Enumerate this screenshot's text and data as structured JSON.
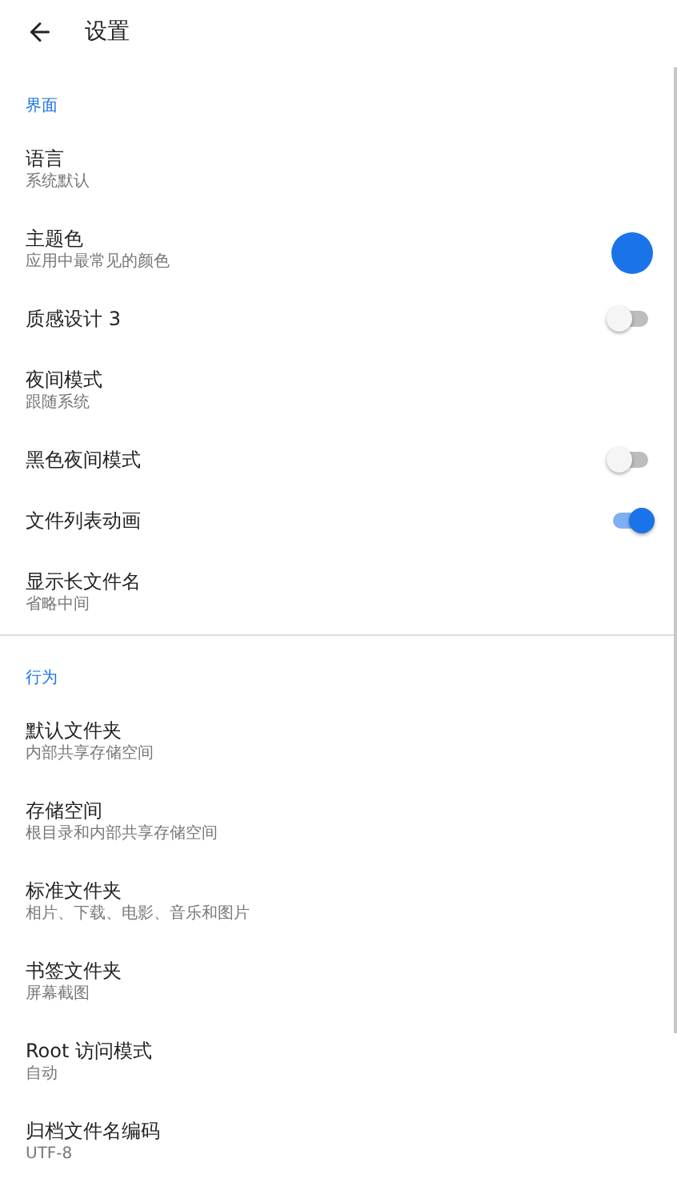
{
  "app_bar": {
    "title": "设置"
  },
  "sections": [
    {
      "header": "界面",
      "items": [
        {
          "kind": "plain",
          "title": "语言",
          "subtitle": "系统默认"
        },
        {
          "kind": "color",
          "title": "主题色",
          "subtitle": "应用中最常见的颜色",
          "color": "#1a73e8"
        },
        {
          "kind": "switch",
          "title": "质感设计 3",
          "on": false
        },
        {
          "kind": "plain",
          "title": "夜间模式",
          "subtitle": "跟随系统"
        },
        {
          "kind": "switch",
          "title": "黑色夜间模式",
          "on": false
        },
        {
          "kind": "switch",
          "title": "文件列表动画",
          "on": true
        },
        {
          "kind": "plain",
          "title": "显示长文件名",
          "subtitle": "省略中间"
        }
      ]
    },
    {
      "header": "行为",
      "items": [
        {
          "kind": "plain",
          "title": "默认文件夹",
          "subtitle": "内部共享存储空间"
        },
        {
          "kind": "plain",
          "title": "存储空间",
          "subtitle": "根目录和内部共享存储空间"
        },
        {
          "kind": "plain",
          "title": "标准文件夹",
          "subtitle": "相片、下载、电影、音乐和图片"
        },
        {
          "kind": "plain",
          "title": "书签文件夹",
          "subtitle": "屏幕截图"
        },
        {
          "kind": "plain",
          "title": "Root 访问模式",
          "subtitle": "自动"
        },
        {
          "kind": "plain",
          "title": "归档文件名编码",
          "subtitle": "UTF-8"
        }
      ]
    }
  ]
}
